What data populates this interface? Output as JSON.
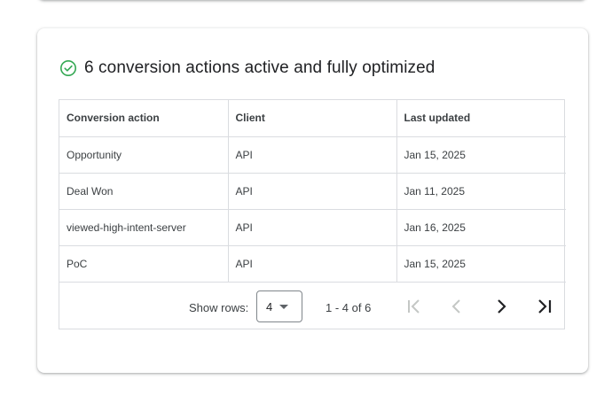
{
  "card": {
    "title": "6 conversion actions active and fully optimized",
    "status_icon": "check-circle-icon",
    "accent_color": "#34a853"
  },
  "table": {
    "columns": [
      "Conversion action",
      "Client",
      "Last updated"
    ],
    "rows": [
      [
        "Opportunity",
        "API",
        "Jan 15, 2025"
      ],
      [
        "Deal Won",
        "API",
        "Jan 11, 2025"
      ],
      [
        "viewed-high-intent-server",
        "API",
        "Jan 16, 2025"
      ],
      [
        "PoC",
        "API",
        "Jan 15, 2025"
      ]
    ]
  },
  "pagination": {
    "show_rows_label": "Show rows:",
    "rows_per_page": "4",
    "range_label": "1 - 4 of 6",
    "icons": [
      "first-page-icon",
      "previous-page-icon",
      "next-page-icon",
      "last-page-icon"
    ]
  }
}
